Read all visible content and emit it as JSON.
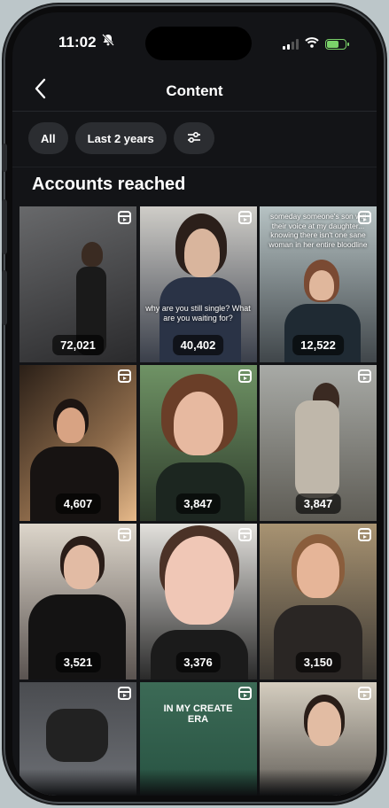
{
  "status": {
    "time": "11:02"
  },
  "header": {
    "title": "Content",
    "back_icon": "chevron-left-icon"
  },
  "filters": {
    "all_label": "All",
    "range_label": "Last 2 years",
    "settings_icon": "sliders-icon"
  },
  "section": {
    "title": "Accounts reached"
  },
  "tiles": [
    {
      "count": "72,021",
      "colors": [
        "#5c5c5e",
        "#2c2c2e"
      ]
    },
    {
      "count": "40,402",
      "caption": "why are you still single?\nWhat are you waiting for?",
      "colors": [
        "#c9c7c2",
        "#2a2f3a"
      ]
    },
    {
      "count": "12,522",
      "caption": "someday someone's son will\ntheir voice at my daughter...\nknowing there isn't one sane\nwoman in her entire bloodline",
      "colors": [
        "#a9b7b8",
        "#33383c"
      ]
    },
    {
      "count": "4,607",
      "colors": [
        "#2a1f17",
        "#d6a87a"
      ]
    },
    {
      "count": "3,847",
      "colors": [
        "#58814f",
        "#2d3a2a"
      ]
    },
    {
      "count": "3,847",
      "colors": [
        "#9a9a94",
        "#6d6b63"
      ]
    },
    {
      "count": "3,521",
      "colors": [
        "#d9d2c7",
        "#1e1c1c"
      ]
    },
    {
      "count": "3,376",
      "colors": [
        "#d8d6d2",
        "#2a2a2a"
      ]
    },
    {
      "count": "3,150",
      "colors": [
        "#a39071",
        "#2c2a28"
      ]
    },
    {
      "count": "",
      "colors": [
        "#3b3b3d",
        "#6e7075"
      ]
    },
    {
      "count": "",
      "caption": "IN MY CREATE ERA",
      "colors": [
        "#1f4a3a",
        "#3c5f4e"
      ]
    },
    {
      "count": "",
      "colors": [
        "#cfc8bb",
        "#2c2a28"
      ]
    }
  ]
}
